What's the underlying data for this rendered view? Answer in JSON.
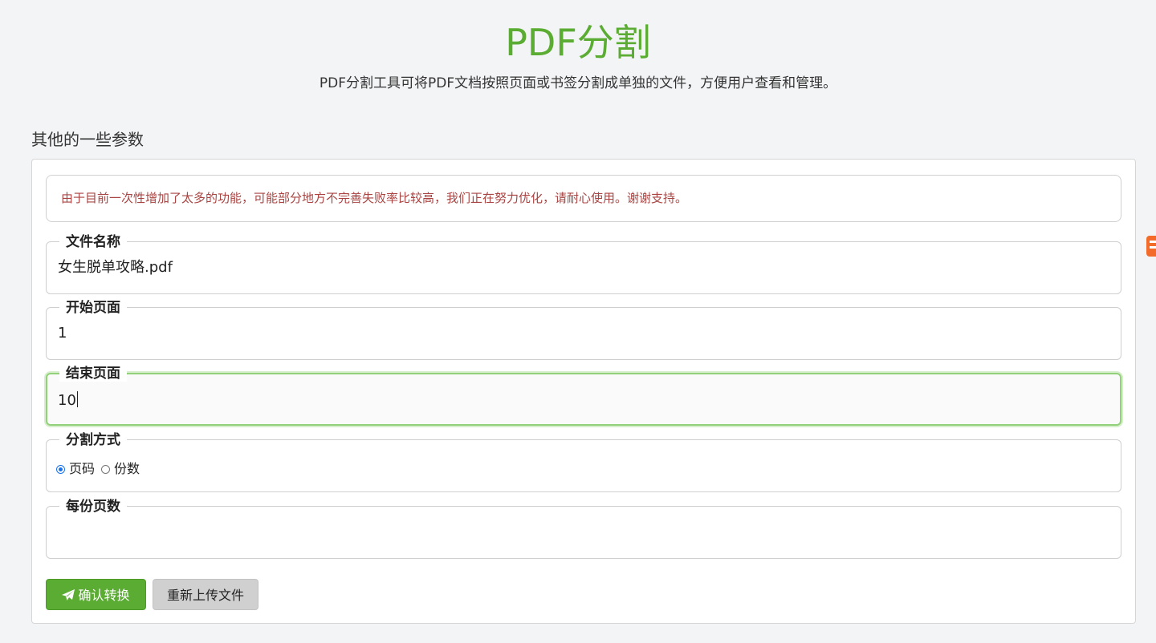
{
  "header": {
    "title": "PDF分割",
    "subtitle": "PDF分割工具可将PDF文档按照页面或书签分割成单独的文件，方便用户查看和管理。"
  },
  "section": {
    "label": "其他的一些参数"
  },
  "notice": {
    "text": "由于目前一次性增加了太多的功能，可能部分地方不完善失败率比较高，我们正在努力优化，请耐心使用。谢谢支持。"
  },
  "fields": {
    "file_name": {
      "label": "文件名称",
      "value": "女生脱单攻略.pdf"
    },
    "start_page": {
      "label": "开始页面",
      "value": "1"
    },
    "end_page": {
      "label": "结束页面",
      "value": "10"
    },
    "split_mode": {
      "label": "分割方式",
      "options": [
        "页码",
        "份数"
      ],
      "selected": "页码"
    },
    "pages_per_part": {
      "label": "每份页数",
      "value": ""
    }
  },
  "buttons": {
    "confirm_label": "确认转换",
    "reupload_label": "重新上传文件"
  },
  "colors": {
    "accent": "#5aac32",
    "notice_text": "#a94442",
    "focus_border": "#93d07a",
    "radio_checked": "#1a73e8"
  },
  "icons": {
    "confirm": "paper-plane-icon",
    "edge_badge": "orange-side-badge-icon"
  }
}
